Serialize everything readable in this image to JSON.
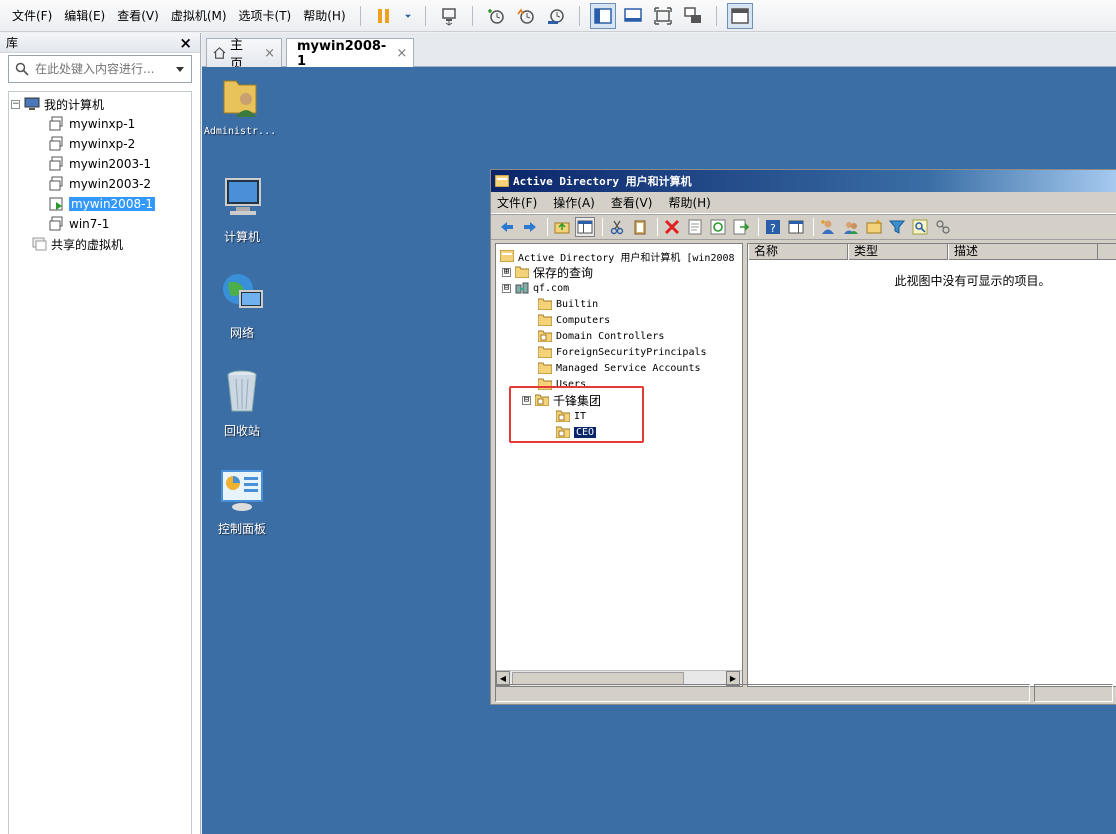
{
  "vmware": {
    "menu": [
      "文件(F)",
      "编辑(E)",
      "查看(V)",
      "虚拟机(M)",
      "选项卡(T)",
      "帮助(H)"
    ],
    "toolbar_icons": [
      "pause-icon",
      "dropdown-arrow-icon",
      "send-ctrl-alt-del-icon",
      "snapshot-take-icon",
      "snapshot-revert-icon",
      "snapshot-manager-icon",
      "library-view-icon",
      "console-view-icon",
      "fullscreen-icon",
      "unity-icon",
      "thumbnail-view-icon"
    ]
  },
  "library": {
    "title": "库",
    "close": "×",
    "search_placeholder": "在此处键入内容进行...",
    "tree": [
      {
        "label": "我的计算机",
        "expander": "⊟"
      },
      {
        "label": "mywinxp-1"
      },
      {
        "label": "mywinxp-2"
      },
      {
        "label": "mywin2003-1"
      },
      {
        "label": "mywin2003-2"
      },
      {
        "label": "mywin2008-1",
        "selected": true
      },
      {
        "label": "win7-1"
      },
      {
        "label": "共享的虚拟机"
      }
    ]
  },
  "tabs": [
    {
      "label": "主页",
      "close": "×"
    },
    {
      "label": "mywin2008-1",
      "close": "×",
      "active": true
    }
  ],
  "desktop": {
    "icons": [
      "Administr...",
      "计算机",
      "网络",
      "回收站",
      "控制面板"
    ]
  },
  "aduc": {
    "title": "Active Directory 用户和计算机",
    "menu": [
      "文件(F)",
      "操作(A)",
      "查看(V)",
      "帮助(H)"
    ],
    "tree": [
      {
        "label": "Active Directory 用户和计算机 [win2008",
        "expander": ""
      },
      {
        "label": "保存的查询",
        "expander": "⊞"
      },
      {
        "label": "qf.com",
        "expander": "⊟"
      },
      {
        "label": "Builtin"
      },
      {
        "label": "Computers"
      },
      {
        "label": "Domain Controllers"
      },
      {
        "label": "ForeignSecurityPrincipals"
      },
      {
        "label": "Managed Service Accounts"
      },
      {
        "label": "Users"
      },
      {
        "label": "千锋集团",
        "expander": "⊟"
      },
      {
        "label": "IT"
      },
      {
        "label": "CEO",
        "selected": true
      }
    ],
    "columns": [
      "名称",
      "类型",
      "描述"
    ],
    "empty_message": "此视图中没有可显示的项目。"
  },
  "colors": {
    "desktop_bg": "#3c6ea6",
    "selection": "#3399ff",
    "highlight_box": "#e53935",
    "aduc_titlebar": "#0a246a"
  }
}
